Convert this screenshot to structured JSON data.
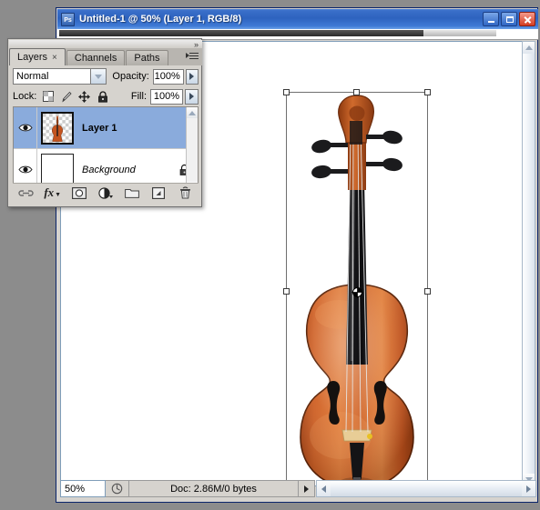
{
  "window": {
    "title": "Untitled-1 @ 50% (Layer 1, RGB/8)",
    "app_icon": "Ps",
    "controls": {
      "minimize": "minimize-icon",
      "maximize": "maximize-icon",
      "close": "close-icon"
    }
  },
  "statusbar": {
    "zoom": "50%",
    "doc_profile_icon": "doc-profile-icon",
    "doc_info": "Doc: 2.86M/0 bytes",
    "info_arrow": "▶"
  },
  "panel": {
    "collapse_arrows": "»",
    "menu_icon": "panel-menu-icon",
    "tabs": [
      {
        "label": "Layers",
        "active": true,
        "closable": true,
        "close_glyph": "×"
      },
      {
        "label": "Channels",
        "active": false,
        "closable": false
      },
      {
        "label": "Paths",
        "active": false,
        "closable": false
      }
    ],
    "blend_mode": "Normal",
    "opacity_label": "Opacity:",
    "opacity_value": "100%",
    "fill_label": "Fill:",
    "fill_value": "100%",
    "lock_label": "Lock:",
    "lock_icons": [
      "lock-transparency-icon",
      "lock-image-icon",
      "lock-position-icon",
      "lock-all-icon"
    ],
    "layers": [
      {
        "name": "Layer 1",
        "selected": true,
        "visible": true,
        "locked": false,
        "thumb": "violin-transparent"
      },
      {
        "name": "Background",
        "selected": false,
        "visible": true,
        "locked": true,
        "thumb": "white"
      }
    ],
    "footer_buttons": [
      "link-layers-icon",
      "layer-style-fx-icon",
      "add-layer-mask-icon",
      "new-adjustment-layer-icon",
      "new-group-icon",
      "new-layer-icon",
      "delete-layer-icon"
    ]
  },
  "canvas": {
    "artwork": "violin",
    "transform_box": true,
    "reference_point": "transform-reference-point",
    "cursor": "diagonal-resize-cursor",
    "handles": [
      "top-left",
      "top-center",
      "top-right",
      "middle-left",
      "middle-right",
      "bottom-left",
      "bottom-center",
      "bottom-right"
    ]
  },
  "colors": {
    "titlebar_blue": "#2e63bf",
    "selection_blue": "#8aabdc",
    "panel_gray": "#d6d3ce",
    "desktop_gray": "#8c8c8c",
    "violin_wood": "#c4541f",
    "violin_dark": "#1c1c1c"
  }
}
